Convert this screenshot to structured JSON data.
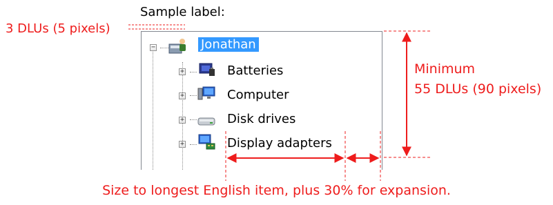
{
  "sample_label": "Sample label:",
  "spacing_label": "3 DLUs (5 pixels)",
  "height_label_line1": "Minimum",
  "height_label_line2": "55 DLUs (90 pixels)",
  "width_note": "Size to longest English item, plus 30% for expansion.",
  "tree": {
    "root": {
      "label": "Jonathan",
      "expander": "−",
      "icon": "computer-user-icon",
      "selected": true
    },
    "children": [
      {
        "label": "Batteries",
        "expander": "+",
        "icon": "battery-icon"
      },
      {
        "label": "Computer",
        "expander": "+",
        "icon": "monitor-icon"
      },
      {
        "label": "Disk drives",
        "expander": "+",
        "icon": "disk-drive-icon"
      },
      {
        "label": "Display adapters",
        "expander": "+",
        "icon": "display-adapter-icon"
      }
    ]
  },
  "colors": {
    "annotation": "#ee1c1c",
    "selection": "#3399ff",
    "border": "#828790"
  }
}
